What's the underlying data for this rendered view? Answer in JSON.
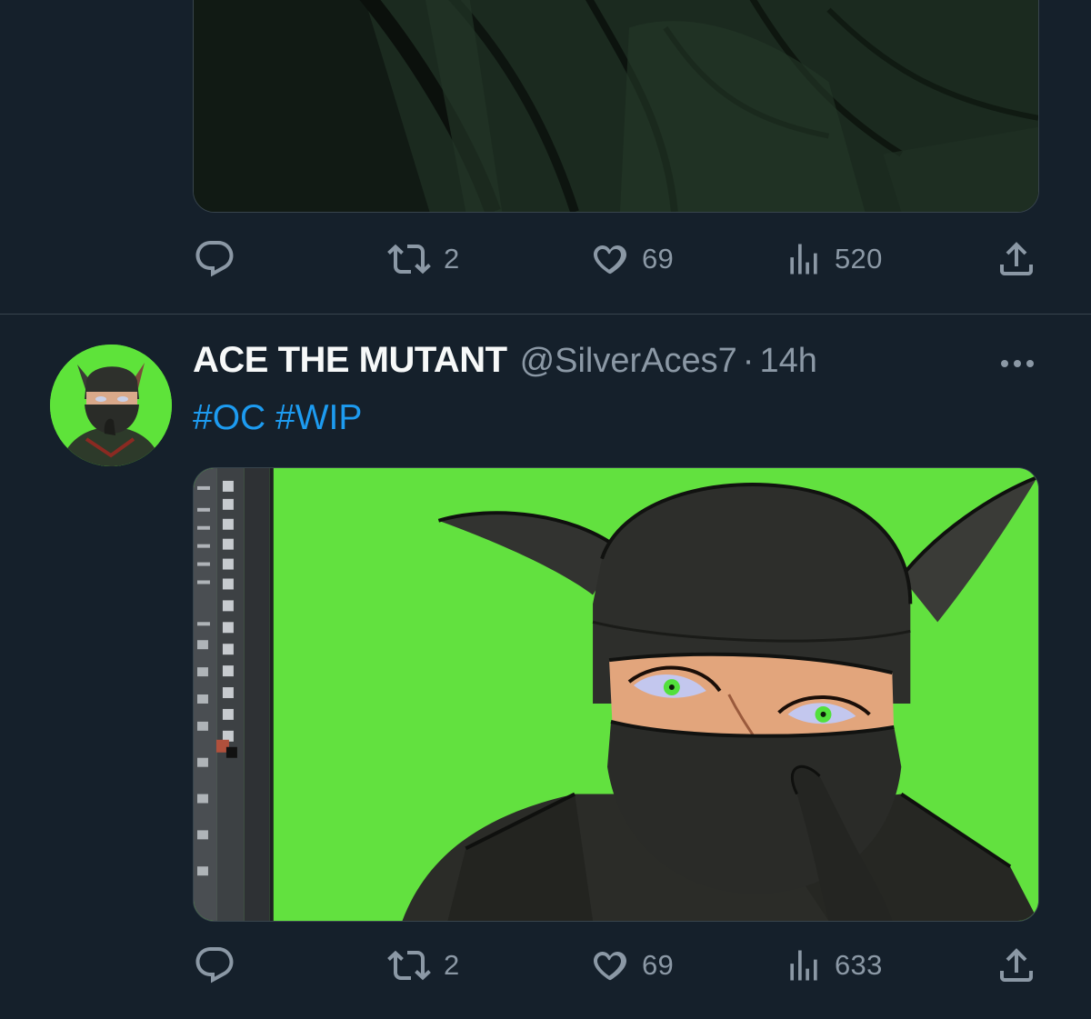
{
  "previous_tweet": {
    "stats": {
      "retweets": "2",
      "likes": "69",
      "views": "520"
    }
  },
  "tweet": {
    "display_name": "ACE THE MUTANT",
    "handle": "@SilverAces7",
    "separator": "·",
    "time": "14h",
    "hashtags": [
      "#OC",
      "#WIP"
    ],
    "stats": {
      "retweets": "2",
      "likes": "69",
      "views": "633"
    }
  },
  "icons": {
    "reply": "reply-icon",
    "retweet": "retweet-icon",
    "like": "heart-icon",
    "views": "views-icon",
    "share": "share-icon",
    "more": "more-icon"
  },
  "colors": {
    "background": "#15202b",
    "divider": "#38444d",
    "secondary_text": "#8b98a5",
    "link": "#1d9bf0",
    "media_green": "#63e23f"
  }
}
